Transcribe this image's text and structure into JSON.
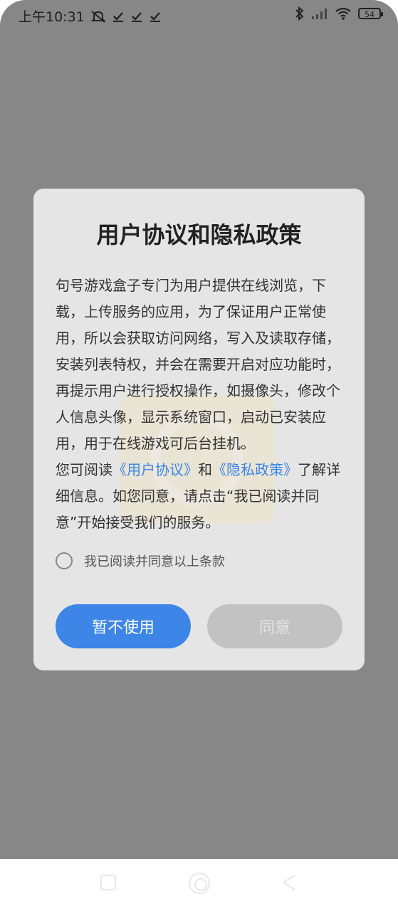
{
  "status_bar": {
    "time": "上午10:31",
    "battery": "54",
    "left_icons": [
      "mute-icon",
      "check-icon",
      "check-icon",
      "check-icon"
    ],
    "right_icons": [
      "bluetooth-icon",
      "signal-icon",
      "wifi-icon",
      "battery-icon"
    ]
  },
  "dialog": {
    "title": "用户协议和隐私政策",
    "paragraph1": "句号游戏盒子专门为用户提供在线浏览，下载，上传服务的应用，为了保证用户正常使用，所以会获取访问网络，写入及读取存储，安装列表特权，并会在需要开启对应功能时，再提示用户进行授权操作，如摄像头，修改个人信息头像，显示系统窗口，启动已安装应用，用于在线游戏可后台挂机。",
    "paragraph2_prefix": "您可阅读",
    "user_agreement_link": "《用户协议》",
    "paragraph2_and": "和",
    "privacy_policy_link": "《隐私政策》",
    "paragraph2_suffix": "了解详细信息。如您同意，请点击“我已阅读并同意”开始接受我们的服务。",
    "agree_checkbox_label": "我已阅读并同意以上条款",
    "decline_button": "暂不使用",
    "agree_button": "同意"
  },
  "colors": {
    "overlay": "#878787",
    "dialog_bg": "#e5e5e5",
    "accent": "#3d85e6",
    "link": "#3a86e8",
    "disabled_button": "#c2c2c2"
  }
}
